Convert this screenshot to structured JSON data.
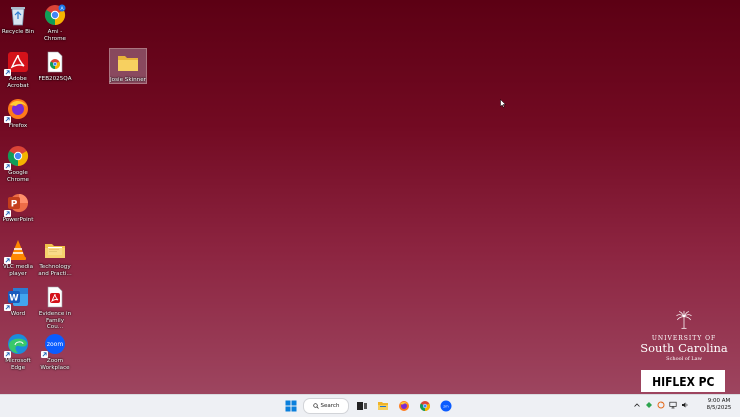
{
  "desktop": {
    "icons": [
      {
        "label": "Recycle Bin",
        "icon": "recycle-bin-icon"
      },
      {
        "label": "Ami - Chrome",
        "icon": "chrome-profile-icon"
      },
      {
        "label": "Adobe Acrobat",
        "icon": "adobe-acrobat-icon"
      },
      {
        "label": "FEB2025QA",
        "icon": "chrome-file-icon"
      },
      {
        "label": "Josie Skinner",
        "icon": "folder-icon"
      },
      {
        "label": "Firefox",
        "icon": "firefox-icon"
      },
      {
        "label": "Google Chrome",
        "icon": "google-chrome-icon"
      },
      {
        "label": "PowerPoint",
        "icon": "powerpoint-icon"
      },
      {
        "label": "VLC media player",
        "icon": "vlc-icon"
      },
      {
        "label": "Technology and Practi...",
        "icon": "folder-icon"
      },
      {
        "label": "Word",
        "icon": "word-icon"
      },
      {
        "label": "Evidence in Family Cou...",
        "icon": "pdf-file-icon"
      },
      {
        "label": "Microsoft Edge",
        "icon": "edge-icon"
      },
      {
        "label": "Zoom Workplace",
        "icon": "zoom-icon"
      }
    ]
  },
  "branding": {
    "university": "UNIVERSITY OF",
    "state": "South Carolina",
    "school": "School of Law",
    "hiflex": "HIFLEX PC"
  },
  "taskbar": {
    "search_label": "Search",
    "apps": [
      "windows-start-icon",
      "search-icon",
      "task-view-icon",
      "file-explorer-icon",
      "firefox-icon",
      "google-chrome-icon",
      "zoom-icon"
    ],
    "tray": [
      "chevron-up-icon",
      "network-icon",
      "update-icon",
      "display-icon",
      "volume-icon"
    ],
    "time": "9:00 AM",
    "date": "8/5/2025"
  },
  "colors": {
    "desktop_top": "#5c0014",
    "desktop_bottom": "#a04a64",
    "taskbar": "#eef0f4"
  }
}
